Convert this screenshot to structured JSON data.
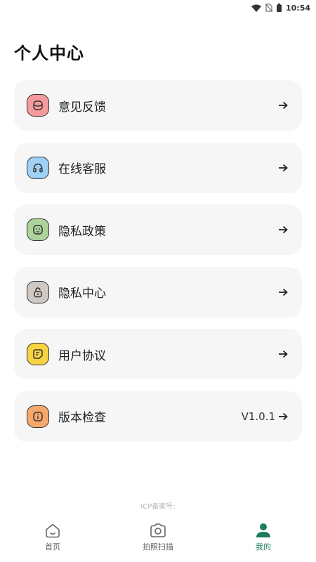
{
  "status_bar": {
    "time": "10:54",
    "icons": [
      "wifi-icon",
      "no-sim-icon",
      "battery-icon"
    ]
  },
  "page_title": "个人中心",
  "menu": [
    {
      "key": "feedback",
      "label": "意见反馈",
      "icon": "feedback-icon",
      "icon_bg": "#f59a9d",
      "value": ""
    },
    {
      "key": "online-service",
      "label": "在线客服",
      "icon": "headset-icon",
      "icon_bg": "#9fd0f5",
      "value": ""
    },
    {
      "key": "privacy-policy",
      "label": "隐私政策",
      "icon": "face-icon",
      "icon_bg": "#aed39a",
      "value": ""
    },
    {
      "key": "privacy-center",
      "label": "隐私中心",
      "icon": "lock-icon",
      "icon_bg": "#cfc8c3",
      "value": ""
    },
    {
      "key": "user-agreement",
      "label": "用户协议",
      "icon": "document-icon",
      "icon_bg": "#f8d442",
      "value": ""
    },
    {
      "key": "version-check",
      "label": "版本检查",
      "icon": "info-icon",
      "icon_bg": "#f6a86b",
      "value": "V1.0.1"
    }
  ],
  "icp_text": "ICP备案号:",
  "nav": [
    {
      "key": "home",
      "label": "首页",
      "icon": "home-icon",
      "active": false
    },
    {
      "key": "scan",
      "label": "拍照扫描",
      "icon": "camera-icon",
      "active": false
    },
    {
      "key": "mine",
      "label": "我的",
      "icon": "user-icon",
      "active": true
    }
  ],
  "colors": {
    "accent": "#1b7d5f",
    "card_bg": "#f6f6f6",
    "nav_inactive": "#666666"
  }
}
